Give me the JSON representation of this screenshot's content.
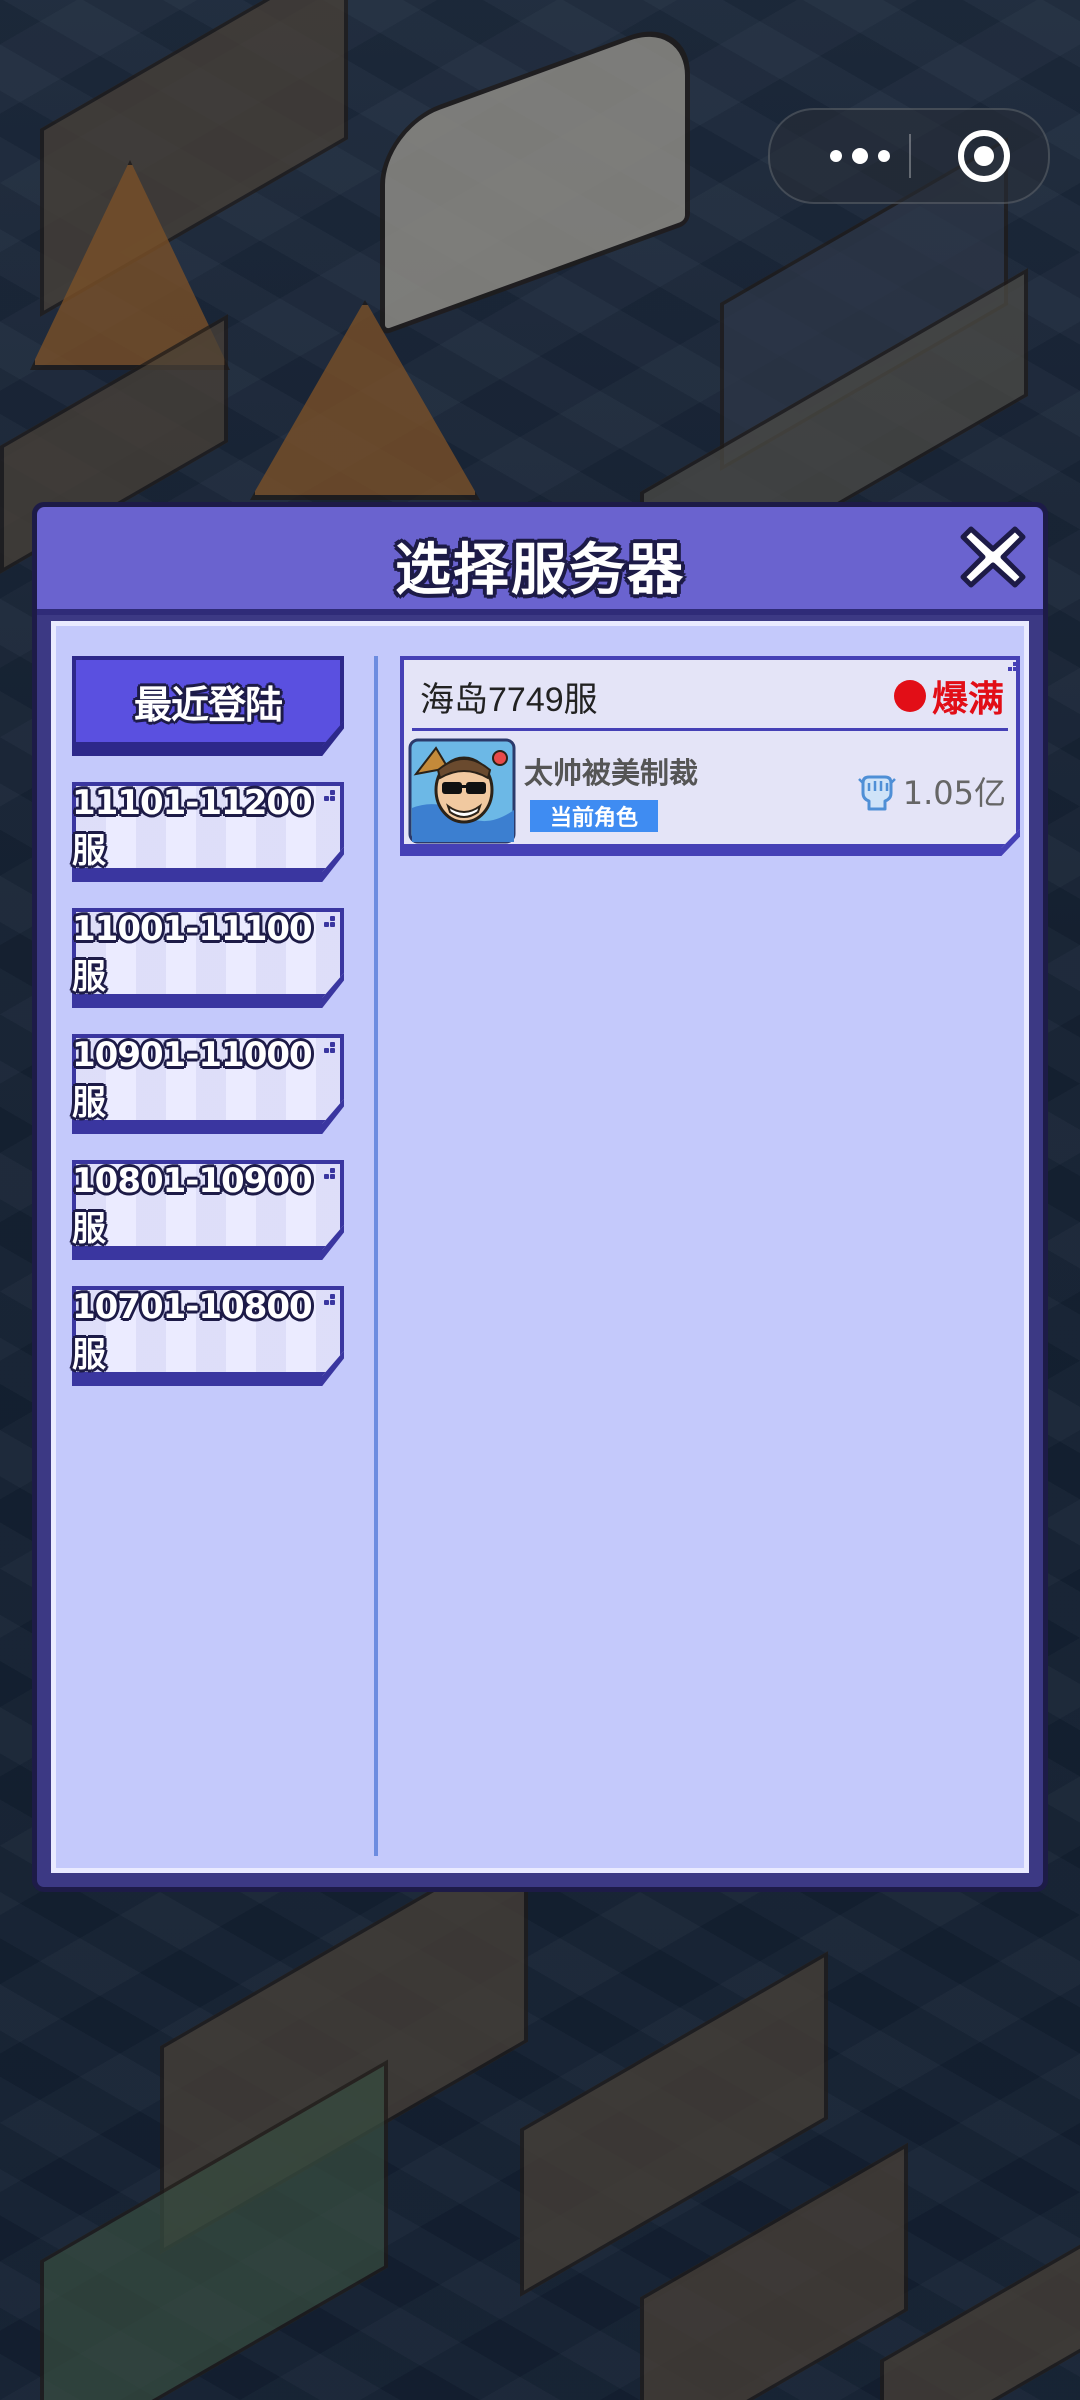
{
  "dialog": {
    "title": "选择服务器"
  },
  "server_groups": [
    {
      "label": "最近登陆",
      "active": true
    },
    {
      "label": "11101-11200服",
      "active": false
    },
    {
      "label": "11001-11100服",
      "active": false
    },
    {
      "label": "10901-11000服",
      "active": false
    },
    {
      "label": "10801-10900服",
      "active": false
    },
    {
      "label": "10701-10800服",
      "active": false
    }
  ],
  "server_card": {
    "server_name": "海岛7749服",
    "status_text": "爆满",
    "status_color": "#e20e17",
    "role_name": "太帅被美制裁",
    "role_tag": "当前角色",
    "power": "1.05亿",
    "power_icon": "fist-icon"
  },
  "colors": {
    "header": "#6a63cf",
    "body": "#c4c9fb",
    "active_tab": "#5a50e0",
    "tag_blue": "#3f8cf2"
  }
}
